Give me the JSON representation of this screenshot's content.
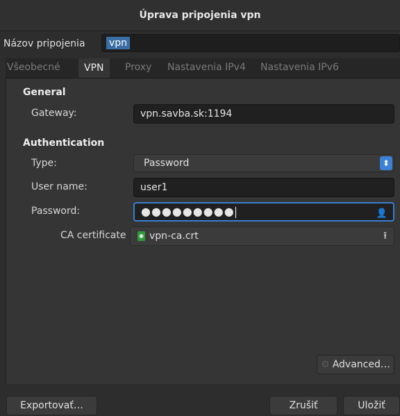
{
  "window": {
    "title": "Úprava pripojenia vpn"
  },
  "connection_name": {
    "label": "Názov pripojenia",
    "value": "vpn"
  },
  "tabs": [
    {
      "label": "Všeobecné",
      "active": false
    },
    {
      "label": "VPN",
      "active": true
    },
    {
      "label": "Proxy",
      "active": false
    },
    {
      "label": "Nastavenia IPv4",
      "active": false
    },
    {
      "label": "Nastavenia IPv6",
      "active": false
    }
  ],
  "general": {
    "heading": "General",
    "gateway_label": "Gateway:",
    "gateway_value": "vpn.savba.sk:1194"
  },
  "auth": {
    "heading": "Authentication",
    "type_label": "Type:",
    "type_value": "Password",
    "username_label": "User name:",
    "username_value": "user1",
    "password_label": "Password:",
    "password_value": "●●●●●●●●●",
    "ca_label": "CA certificate",
    "ca_value": "vpn-ca.crt"
  },
  "buttons": {
    "advanced": "Advanced…",
    "export": "Exportovať…",
    "cancel": "Zrušiť",
    "save": "Uložiť"
  },
  "colors": {
    "accent": "#3a7fd1",
    "background": "#2d2d2d"
  },
  "icons": [
    "password-options-icon",
    "certificate-file-icon",
    "upload-icon",
    "gear-icon",
    "combo-arrows-icon"
  ]
}
